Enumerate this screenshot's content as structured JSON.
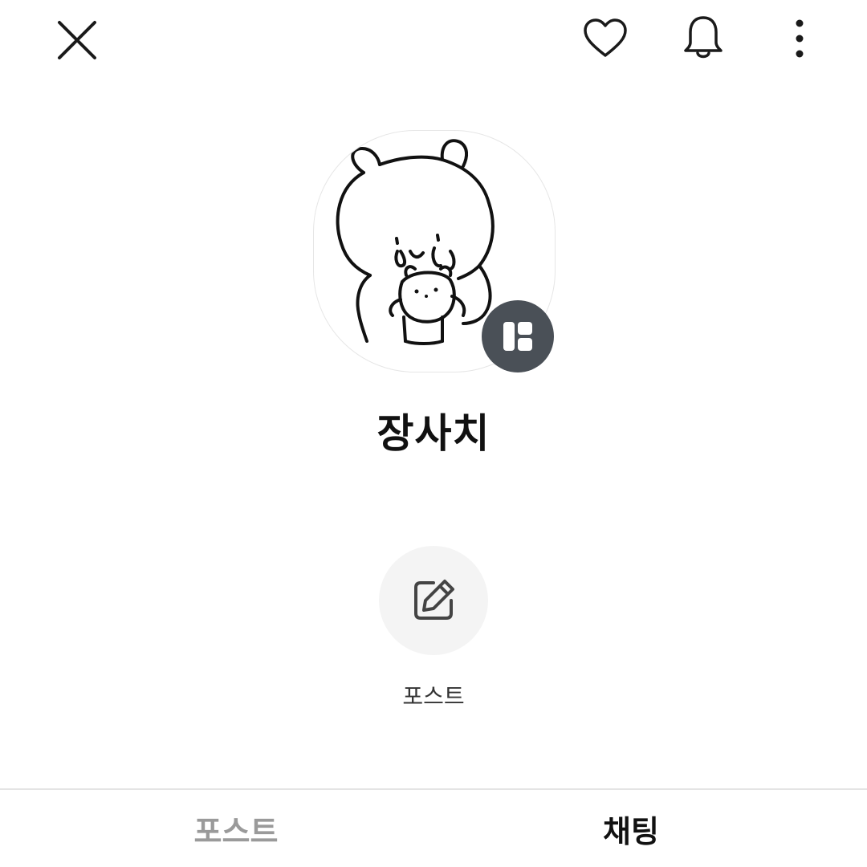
{
  "header": {
    "icons": [
      "close-icon",
      "heart-icon",
      "bell-icon",
      "more-vertical-icon"
    ]
  },
  "profile": {
    "name": "장사치",
    "avatar_icon": "bear-cartoon-avatar",
    "badge_icon": "channel-badge-icon"
  },
  "actions": {
    "post_label": "포스트",
    "post_icon": "edit-icon"
  },
  "tabs": [
    {
      "label": "포스트",
      "active": false
    },
    {
      "label": "채팅",
      "active": true
    }
  ],
  "colors": {
    "badge_bg": "#4a5057",
    "active_tab": "#111111",
    "inactive_tab": "#9a9a9a",
    "action_circle": "#f4f4f4"
  }
}
